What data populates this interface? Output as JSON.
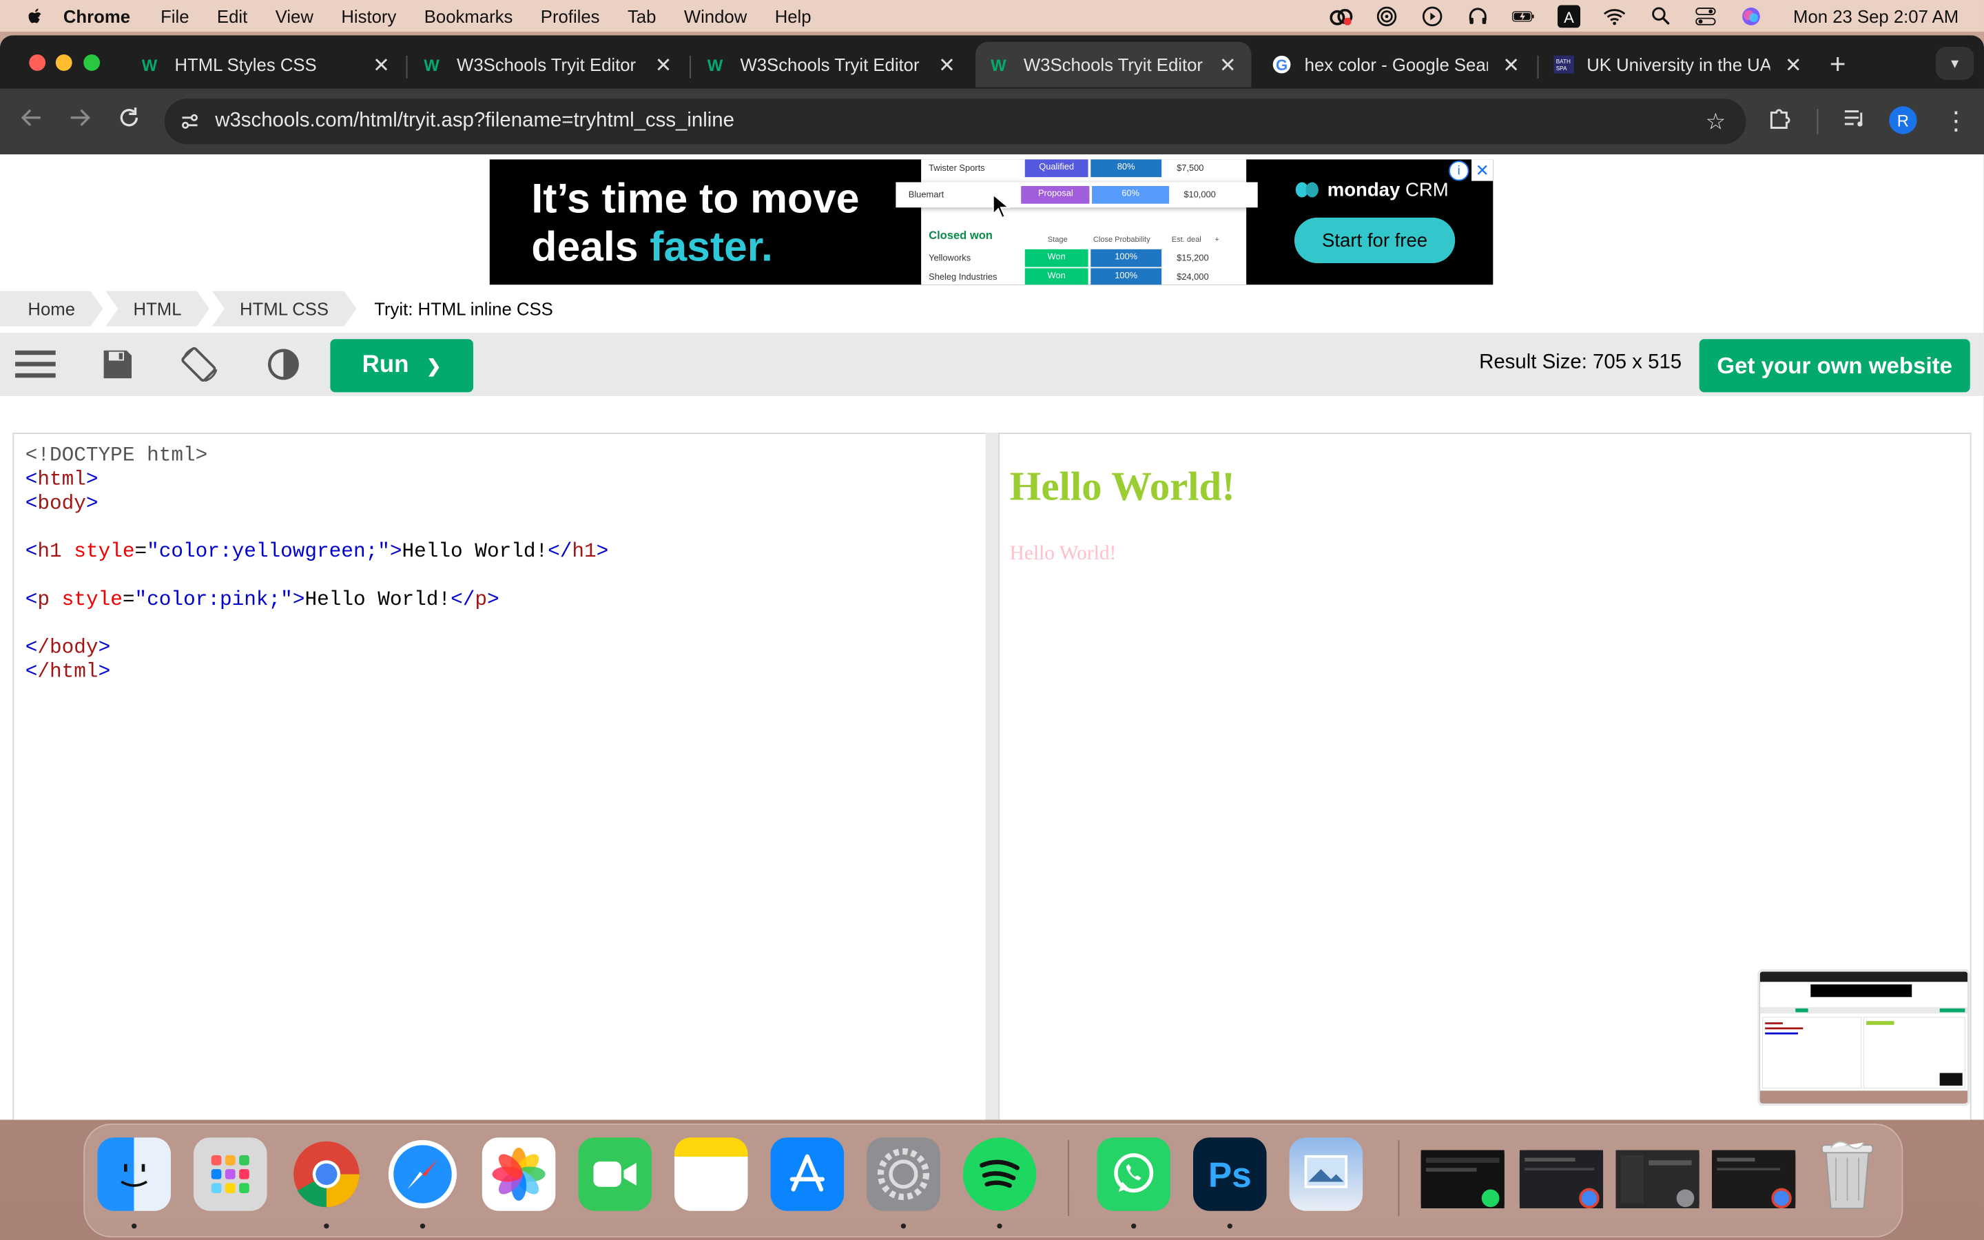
{
  "menubar": {
    "app": "Chrome",
    "items": [
      "File",
      "Edit",
      "View",
      "History",
      "Bookmarks",
      "Profiles",
      "Tab",
      "Window",
      "Help"
    ],
    "clock": "Mon 23 Sep  2:07 AM"
  },
  "tabs": [
    {
      "title": "HTML Styles CSS"
    },
    {
      "title": "W3Schools Tryit Editor"
    },
    {
      "title": "W3Schools Tryit Editor"
    },
    {
      "title": "W3Schools Tryit Editor"
    },
    {
      "title": "hex color - Google Search"
    },
    {
      "title": "UK University in the UAE"
    }
  ],
  "address": {
    "url": "w3schools.com/html/tryit.asp?filename=tryhtml_css_inline"
  },
  "profile_initial": "R",
  "ad": {
    "headline_1": "It’s time to move",
    "headline_2a": "deals ",
    "headline_2b": "faster.",
    "brand": "monday",
    "brand_suffix": " CRM",
    "cta": "Start for free",
    "rows": [
      {
        "name": "Twister Sports",
        "stage": "Qualified",
        "prob": "80%",
        "deal": "$7,500"
      },
      {
        "name": "Bluemart",
        "stage": "Proposal",
        "prob": "60%",
        "deal": "$10,000"
      }
    ],
    "closed_label": "Closed won",
    "closed_headers": [
      "Stage",
      "Close Probability",
      "Est. deal",
      "+"
    ],
    "closed_rows": [
      {
        "name": "Yelloworks",
        "stage": "Won",
        "prob": "100%",
        "deal": "$15,200"
      },
      {
        "name": "Sheleg Industries",
        "stage": "Won",
        "prob": "100%",
        "deal": "$24,000"
      }
    ]
  },
  "breadcrumbs": [
    "Home",
    "HTML",
    "HTML CSS",
    "Tryit: HTML inline CSS"
  ],
  "tryit": {
    "run_label": "Run",
    "run_arrow": "❯",
    "result_size": "Result Size: 705 x 515",
    "get_site": "Get your own website"
  },
  "code": {
    "doctype": "<!DOCTYPE html>",
    "html_open": "html",
    "body_open": "body",
    "h1_tag": "h1",
    "h1_attr": "style",
    "h1_val": "\"color:yellowgreen;\"",
    "h1_text": "Hello World!",
    "p_tag": "p",
    "p_attr": "style",
    "p_val": "\"color:pink;\"",
    "p_text": "Hello World!",
    "body_close": "/body",
    "html_close": "/html"
  },
  "result": {
    "h1": "Hello World!",
    "p": "Hello World!"
  },
  "colors": {
    "w3_green": "#04aa6d",
    "h1_color": "yellowgreen",
    "p_color": "pink",
    "ad_accent": "#2ec8d8"
  },
  "dock_apps": [
    "Finder",
    "Launchpad",
    "Chrome",
    "Safari",
    "Photos",
    "FaceTime",
    "Notes",
    "App Store",
    "System Settings",
    "Spotify",
    "WhatsApp",
    "Photoshop",
    "Preview",
    "Trash"
  ]
}
